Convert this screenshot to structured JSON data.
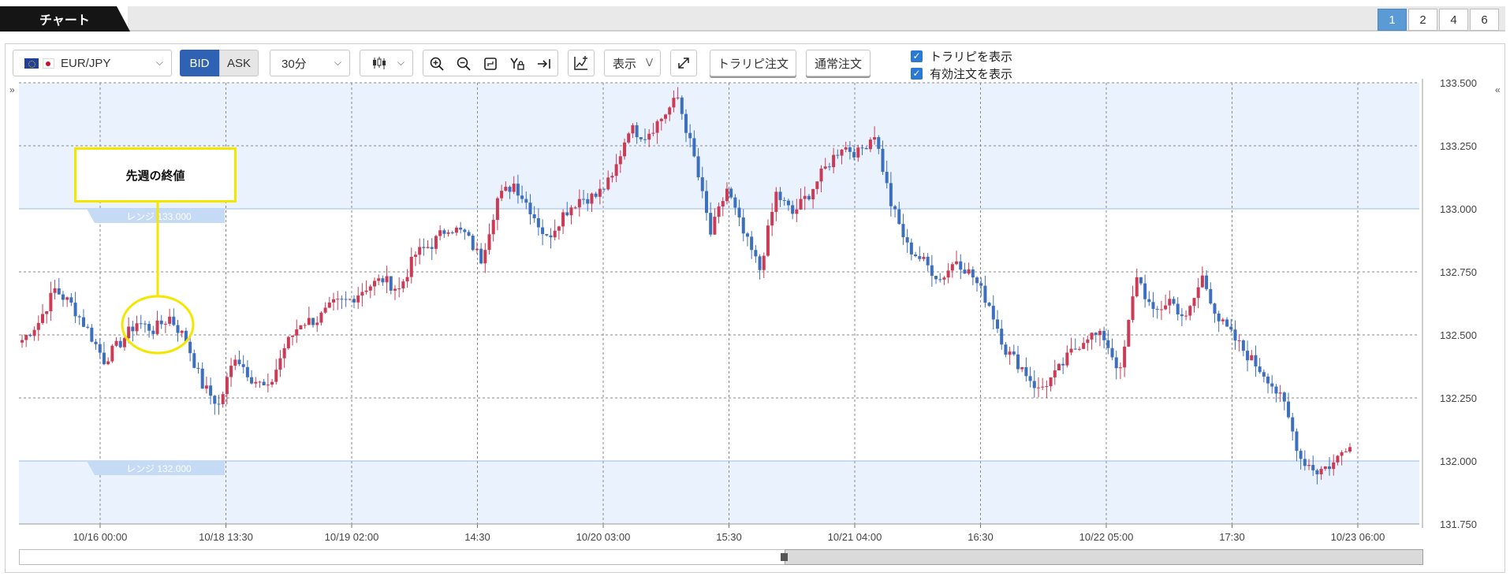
{
  "tab": {
    "title": "チャート"
  },
  "layout_buttons": [
    "1",
    "2",
    "4",
    "6"
  ],
  "toolbar": {
    "symbol": "EUR/JPY",
    "bid_label": "BID",
    "ask_label": "ASK",
    "timeframe": "30分",
    "display_label": "表示",
    "tralipi_order_label": "トラリピ注文",
    "normal_order_label": "通常注文"
  },
  "checkboxes": {
    "show_tralipi": "トラリピを表示",
    "show_active_orders": "有効注文を表示"
  },
  "callout": {
    "text": "先週の終値"
  },
  "colors": {
    "up": "#cc3b55",
    "down": "#3d6fbf",
    "range_band": "#eaf2fd",
    "accent": "#2f61b5"
  },
  "chart_data": {
    "type": "candlestick",
    "instrument": "EUR/JPY",
    "timeframe": "30分",
    "ylim": [
      131.75,
      133.5
    ],
    "y_ticks": [
      "133.500",
      "133.250",
      "133.000",
      "132.750",
      "132.500",
      "132.250",
      "132.000",
      "131.750"
    ],
    "x_ticks": [
      "10/16 00:00",
      "10/18 13:30",
      "10/19 02:00",
      "14:30",
      "10/20 03:00",
      "15:30",
      "10/21 04:00",
      "16:30",
      "10/22 05:00",
      "17:30",
      "10/23 06:00"
    ],
    "range_lines": [
      {
        "label": "レンジ 133.000",
        "value": 133.0
      },
      {
        "label": "レンジ 132.000",
        "value": 132.0
      }
    ],
    "close_path": [
      132.48,
      132.55,
      132.68,
      132.62,
      132.52,
      132.4,
      132.47,
      132.55,
      132.52,
      132.57,
      132.48,
      132.3,
      132.22,
      132.42,
      132.33,
      132.28,
      132.45,
      132.55,
      132.56,
      132.62,
      132.64,
      132.69,
      132.72,
      132.68,
      132.82,
      132.86,
      132.93,
      132.9,
      132.8,
      133.04,
      133.1,
      133.0,
      132.88,
      132.98,
      133.04,
      133.05,
      133.12,
      133.32,
      133.29,
      133.36,
      133.44,
      133.2,
      132.9,
      133.08,
      132.9,
      132.76,
      133.06,
      132.98,
      133.06,
      133.16,
      133.25,
      133.22,
      133.3,
      133.02,
      132.85,
      132.79,
      132.72,
      132.8,
      132.73,
      132.62,
      132.44,
      132.37,
      132.28,
      132.34,
      132.43,
      132.5,
      132.49,
      132.35,
      132.74,
      132.58,
      132.64,
      132.56,
      132.73,
      132.56,
      132.48,
      132.4,
      132.33,
      132.22,
      132.01,
      131.96,
      131.99,
      132.08
    ]
  }
}
